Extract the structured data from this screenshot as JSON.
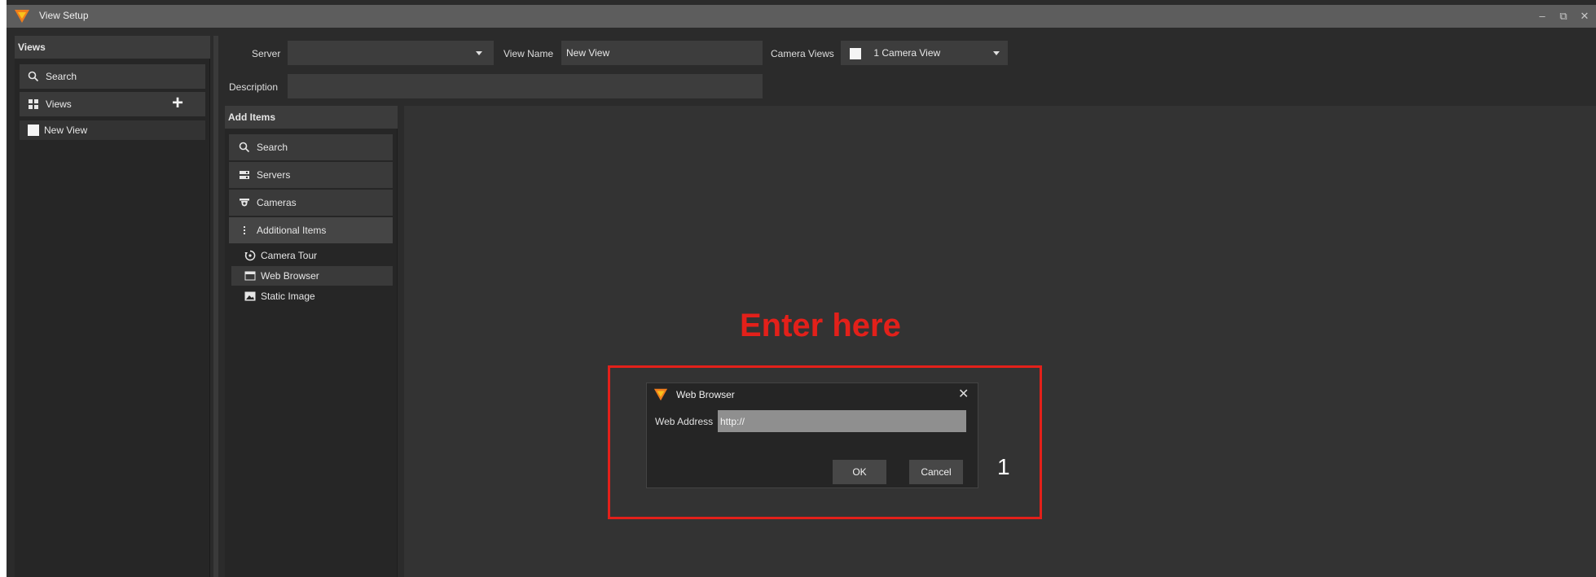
{
  "window": {
    "title": "View Setup",
    "controls": {
      "minimize": "–",
      "restore": "⧉",
      "close": "✕"
    }
  },
  "views_panel": {
    "header": "Views",
    "search_label": "Search",
    "views_label": "Views",
    "add_symbol": "+",
    "items": [
      {
        "label": "New View"
      }
    ]
  },
  "form": {
    "server_label": "Server",
    "server_value": "",
    "view_name_label": "View Name",
    "view_name_value": "New View",
    "camera_views_label": "Camera Views",
    "camera_views_value": "1 Camera View",
    "description_label": "Description",
    "description_value": ""
  },
  "add_items": {
    "header": "Add Items",
    "categories": [
      {
        "label": "Search",
        "icon": "search-icon"
      },
      {
        "label": "Servers",
        "icon": "servers-icon"
      },
      {
        "label": "Cameras",
        "icon": "camera-icon"
      },
      {
        "label": "Additional Items",
        "icon": "more-vertical-icon"
      }
    ],
    "sub_items": [
      {
        "label": "Camera Tour",
        "icon": "camera-tour-icon"
      },
      {
        "label": "Web Browser",
        "icon": "web-browser-icon"
      },
      {
        "label": "Static Image",
        "icon": "image-icon"
      }
    ]
  },
  "annotation": {
    "text": "Enter here",
    "number": "1",
    "color": "#e3201a"
  },
  "dialog": {
    "title": "Web Browser",
    "close": "✕",
    "address_label": "Web Address",
    "address_value": "http://",
    "ok_label": "OK",
    "cancel_label": "Cancel"
  },
  "colors": {
    "brand_orange": "#f07d1c",
    "brand_yellow": "#f8c21c",
    "background": "#2b2b2b",
    "canvas": "#333333"
  }
}
